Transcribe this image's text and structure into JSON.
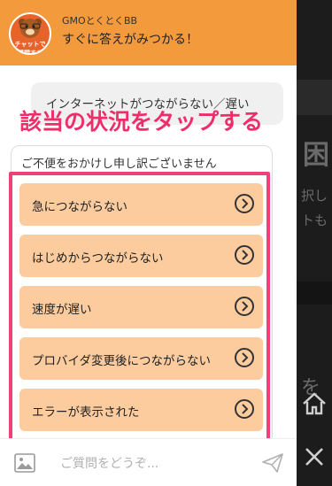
{
  "header": {
    "logo_badge": "チャットで質問する",
    "title": "GMOとくとくBB",
    "subtitle": "すぐに答えがみつかる！"
  },
  "question": {
    "text": "インターネットがつながらない／遅い"
  },
  "annotation": {
    "text": "該当の状況をタップする"
  },
  "answer": {
    "text": "ご不便をおかけし申し訳ございません",
    "options": [
      {
        "label": "急につながらない"
      },
      {
        "label": "はじめからつながらない"
      },
      {
        "label": "速度が遅い"
      },
      {
        "label": "プロバイダ変更後につながらない"
      },
      {
        "label": "エラーが表示された"
      }
    ]
  },
  "footer": {
    "placeholder": "ご質問をどうぞ..."
  },
  "background_page": {
    "glyph_1": "困",
    "glyph_2": "択し",
    "glyph_3": "トも",
    "glyph_4": "を"
  },
  "colors": {
    "header": "#f39a3c",
    "option": "#fccc9f",
    "annotation": "#f02d6b"
  }
}
